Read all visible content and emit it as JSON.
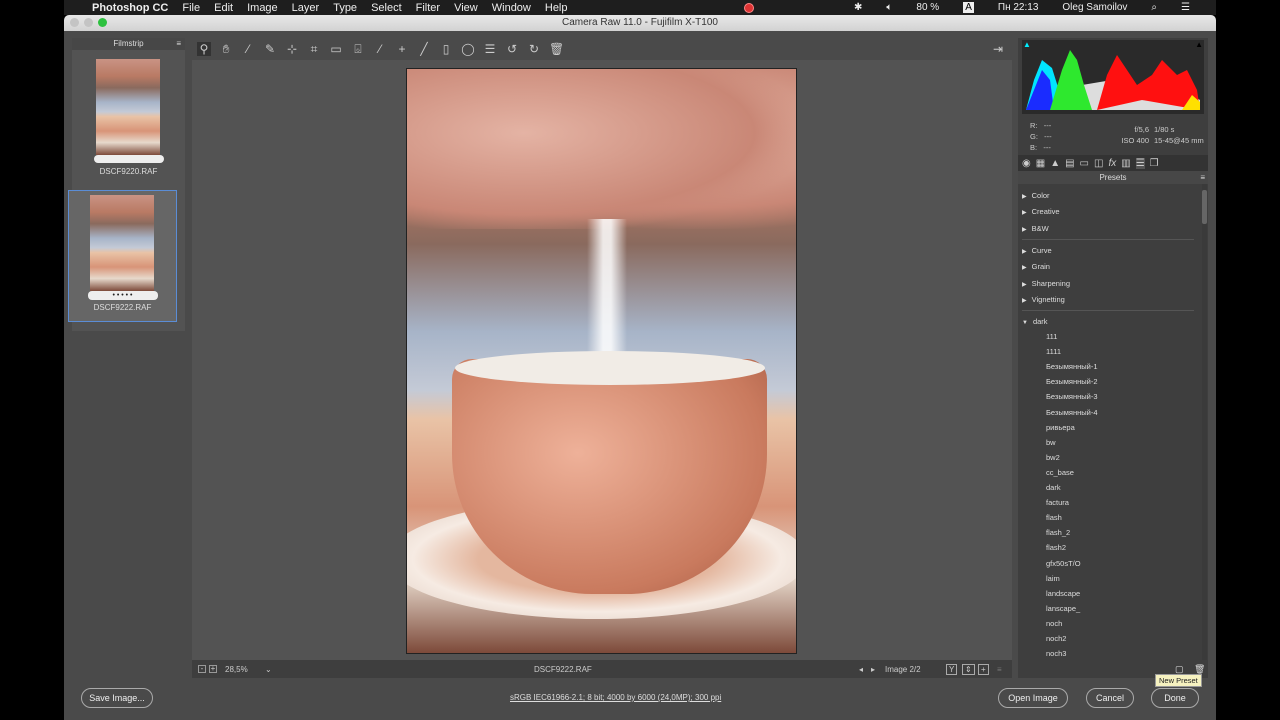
{
  "menubar": {
    "app": "Photoshop CC",
    "items": [
      "File",
      "Edit",
      "Image",
      "Layer",
      "Type",
      "Select",
      "Filter",
      "View",
      "Window",
      "Help"
    ],
    "battery": "80 %",
    "input": "A",
    "clock": "Пн 22:13",
    "user": "Oleg Samoilov"
  },
  "window": {
    "title": "Camera Raw 11.0  -  Fujifilm X-T100"
  },
  "filmstrip": {
    "title": "Filmstrip",
    "items": [
      {
        "name": "DSCF9220.RAF",
        "rating": "",
        "selected": false
      },
      {
        "name": "DSCF9222.RAF",
        "rating": "• • • • •",
        "selected": true
      }
    ]
  },
  "toolbar": {
    "tools": [
      "zoom-icon",
      "hand-icon",
      "white-balance-icon",
      "color-sampler-icon",
      "targeted-adjustment-icon",
      "crop-icon",
      "straighten-icon",
      "transform-icon",
      "spot-removal-icon",
      "red-eye-icon",
      "adjustment-brush-icon",
      "graduated-filter-icon",
      "radial-filter-icon",
      "preferences-icon",
      "rotate-left-icon",
      "rotate-right-icon",
      "trash-icon"
    ]
  },
  "camera_info": {
    "r": "---",
    "g": "---",
    "b": "---",
    "aperture": "f/5,6",
    "shutter": "1/80 s",
    "iso": "ISO 400",
    "lens": "15-45@45 mm"
  },
  "presets": {
    "title": "Presets",
    "groups": [
      {
        "label": "Color"
      },
      {
        "label": "Creative"
      },
      {
        "label": "B&W"
      },
      {
        "label": "Curve"
      },
      {
        "label": "Grain"
      },
      {
        "label": "Sharpening"
      },
      {
        "label": "Vignetting"
      },
      {
        "label": "dark",
        "expanded": true
      }
    ],
    "items": [
      "111",
      "1111",
      "Безымянный-1",
      "Безымянный-2",
      "Безымянный-3",
      "Безымянный-4",
      "ривьера",
      "bw",
      "bw2",
      "cc_base",
      "dark",
      "factura",
      "flash",
      "flash_2",
      "flash2",
      "gfx50sT/O",
      "laim",
      "landscape",
      "lanscape_",
      "noch",
      "noch2",
      "noch3"
    ],
    "tooltip": "New Preset"
  },
  "bottom_bar": {
    "zoom": "28,5%",
    "filename": "DSCF9222.RAF",
    "image_counter": "Image 2/2"
  },
  "footer": {
    "save": "Save Image...",
    "status": "sRGB IEC61966-2.1; 8 bit; 4000 by 6000 (24,0MP); 300 ppi",
    "open": "Open Image",
    "cancel": "Cancel",
    "done": "Done"
  },
  "colors": {
    "accent": "#5b8dd6",
    "background": "#4a4a4a"
  }
}
